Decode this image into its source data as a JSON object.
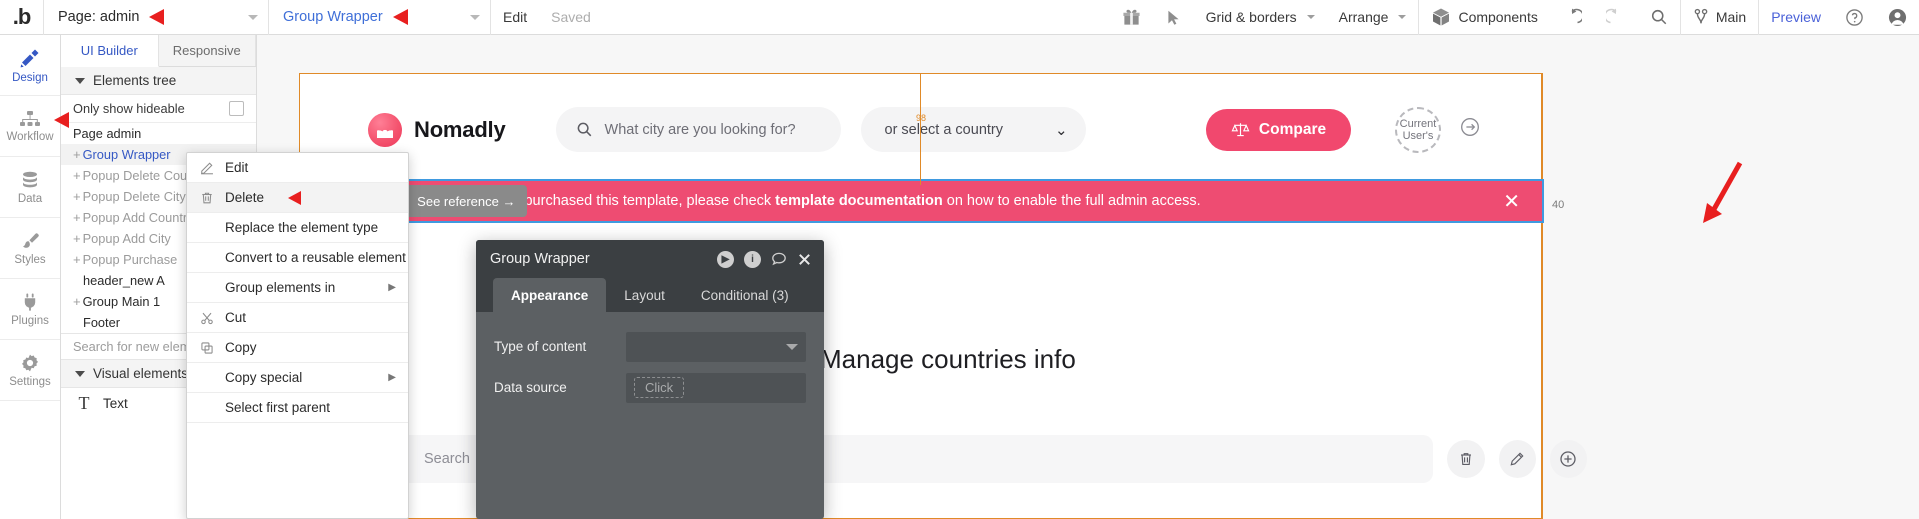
{
  "topbar": {
    "logo": "bubble-logo",
    "page_select": "Page: admin",
    "element_select": "Group Wrapper",
    "edit": "Edit",
    "saved": "Saved",
    "grid_borders": "Grid & borders",
    "arrange": "Arrange",
    "components": "Components",
    "branch": "Main",
    "preview": "Preview"
  },
  "rail": {
    "items": [
      {
        "label": "Design",
        "icon": "design-icon"
      },
      {
        "label": "Workflow",
        "icon": "workflow-icon"
      },
      {
        "label": "Data",
        "icon": "data-icon"
      },
      {
        "label": "Styles",
        "icon": "styles-icon"
      },
      {
        "label": "Plugins",
        "icon": "plugins-icon"
      },
      {
        "label": "Settings",
        "icon": "settings-icon"
      }
    ]
  },
  "panel": {
    "tabs": [
      {
        "label": "UI Builder"
      },
      {
        "label": "Responsive"
      }
    ],
    "section_title": "Elements tree",
    "only_hideable": "Only show hideable",
    "tree": [
      {
        "label": "Page admin",
        "expandable": false,
        "state": "normal"
      },
      {
        "label": "Group Wrapper",
        "expandable": true,
        "state": "selected"
      },
      {
        "label": "Popup Delete Country",
        "expandable": true,
        "state": "dim"
      },
      {
        "label": "Popup Delete City",
        "expandable": true,
        "state": "dim"
      },
      {
        "label": "Popup Add Country",
        "expandable": true,
        "state": "dim"
      },
      {
        "label": "Popup Add City",
        "expandable": true,
        "state": "dim"
      },
      {
        "label": "Popup Purchase",
        "expandable": true,
        "state": "dim"
      },
      {
        "label": "header_new A",
        "expandable": false,
        "state": "normal"
      },
      {
        "label": "Group Main 1",
        "expandable": true,
        "state": "normal"
      },
      {
        "label": "Footer",
        "expandable": false,
        "state": "normal"
      }
    ],
    "search_placeholder": "Search for new element",
    "visual_section": "Visual elements",
    "visual_items": [
      {
        "label": "Text",
        "glyph": "T"
      }
    ]
  },
  "context_menu": {
    "items": [
      {
        "label": "Edit",
        "icon": "pencil-icon",
        "submenu": false,
        "hover": false
      },
      {
        "label": "Delete",
        "icon": "trash-icon",
        "submenu": false,
        "hover": true
      },
      {
        "label": "Replace the element type",
        "icon": "",
        "submenu": false,
        "hover": false
      },
      {
        "label": "Convert to a reusable element",
        "icon": "",
        "submenu": false,
        "hover": false
      },
      {
        "label": "Group elements in",
        "icon": "",
        "submenu": true,
        "hover": false
      },
      {
        "label": "Cut",
        "icon": "scissors-icon",
        "submenu": false,
        "hover": false
      },
      {
        "label": "Copy",
        "icon": "copy-icon",
        "submenu": false,
        "hover": false
      },
      {
        "label": "Copy special",
        "icon": "",
        "submenu": true,
        "hover": false
      },
      {
        "label": "Select first parent",
        "icon": "",
        "submenu": false,
        "hover": false
      }
    ]
  },
  "canvas": {
    "guide_label": "98",
    "right_badge": "40",
    "site": {
      "brand": "Nomadly",
      "search_placeholder": "What city are you looking for?",
      "country_placeholder": "or select a country",
      "compare_label": "Compare",
      "avatar_text": "Current User's",
      "page_title": "Manage countries info",
      "list_search_placeholder": "Search"
    },
    "banner": {
      "ref_badge": "See reference →",
      "text_before": "If you purchased this template, please check ",
      "text_bold": "template documentation",
      "text_after": " on how to enable the full admin access.",
      "close": "✕"
    }
  },
  "property_editor": {
    "title": "Group Wrapper",
    "tabs": [
      {
        "label": "Appearance"
      },
      {
        "label": "Layout"
      },
      {
        "label": "Conditional (3)"
      }
    ],
    "fields": [
      {
        "label": "Type of content",
        "value": ""
      },
      {
        "label": "Data source",
        "value": "Click"
      }
    ]
  },
  "colors": {
    "accent_pink": "#ee4c72",
    "blue_link": "#3558c4",
    "orange_frame": "#e08a28",
    "annotation_red": "#e81f1f",
    "selection_blue": "#3f9ae0"
  }
}
